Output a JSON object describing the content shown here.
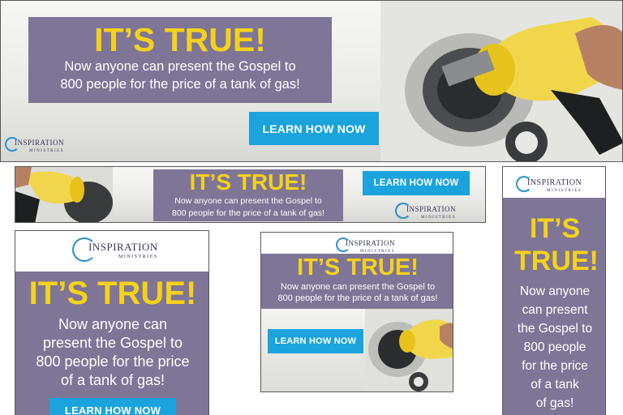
{
  "headline": "IT’S TRUE!",
  "body_text": "Now anyone can present the Gospel to 800 people for the price of a tank of gas!",
  "body_line_1": "Now anyone can present the Gospel to",
  "body_line_2": "800 people for the price of a tank of gas!",
  "tall_lines": [
    "Now anyone",
    "can present",
    "the Gospel to",
    "800 people",
    "for the price",
    "of a tank",
    "of gas!"
  ],
  "square_lines": [
    "Now anyone can",
    "present the Gospel to",
    "800 people for the price",
    "of a tank of gas!"
  ],
  "cta_label": "LEARN HOW NOW",
  "logo": {
    "name": "INSPIRATION",
    "sub": "MINISTRIES",
    "initial": "I",
    "rest": "NSPIRATION"
  },
  "colors": {
    "purple": "#7f7597",
    "yellow": "#f5d21a",
    "button_blue": "#1aa3dc",
    "nozzle": "#f1d64b"
  }
}
